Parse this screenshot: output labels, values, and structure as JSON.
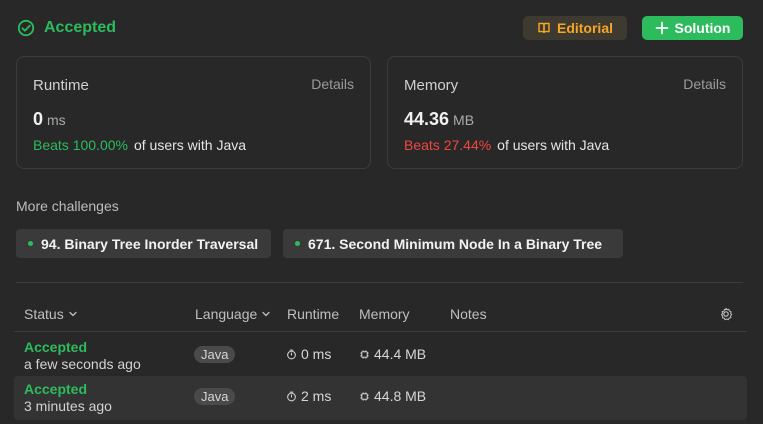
{
  "header": {
    "status": "Accepted",
    "editorial_label": "Editorial",
    "solution_label": "Solution",
    "icons": {
      "status": "check-circle-icon",
      "editorial": "book-icon",
      "solution": "plus-icon"
    }
  },
  "runtime": {
    "label": "Runtime",
    "details": "Details",
    "value": "0",
    "unit": "ms",
    "beats": "Beats 100.00%",
    "suffix": "of users with Java"
  },
  "memory": {
    "label": "Memory",
    "details": "Details",
    "value": "44.36",
    "unit": "MB",
    "beats": "Beats 27.44%",
    "suffix": "of users with Java"
  },
  "more": {
    "title": "More challenges",
    "items": [
      "94. Binary Tree Inorder Traversal",
      "671. Second Minimum Node In a Binary Tree"
    ]
  },
  "table": {
    "columns": {
      "status": "Status",
      "language": "Language",
      "runtime": "Runtime",
      "memory": "Memory",
      "notes": "Notes"
    },
    "rows": [
      {
        "status": "Accepted",
        "time": "a few seconds ago",
        "language": "Java",
        "runtime": "0 ms",
        "memory": "44.4 MB"
      },
      {
        "status": "Accepted",
        "time": "3 minutes ago",
        "language": "Java",
        "runtime": "2 ms",
        "memory": "44.8 MB"
      }
    ]
  },
  "colors": {
    "background": "#282828",
    "accent_green": "#2cbb5d",
    "accent_orange": "#f5a623",
    "danger_red": "#ef4743"
  }
}
